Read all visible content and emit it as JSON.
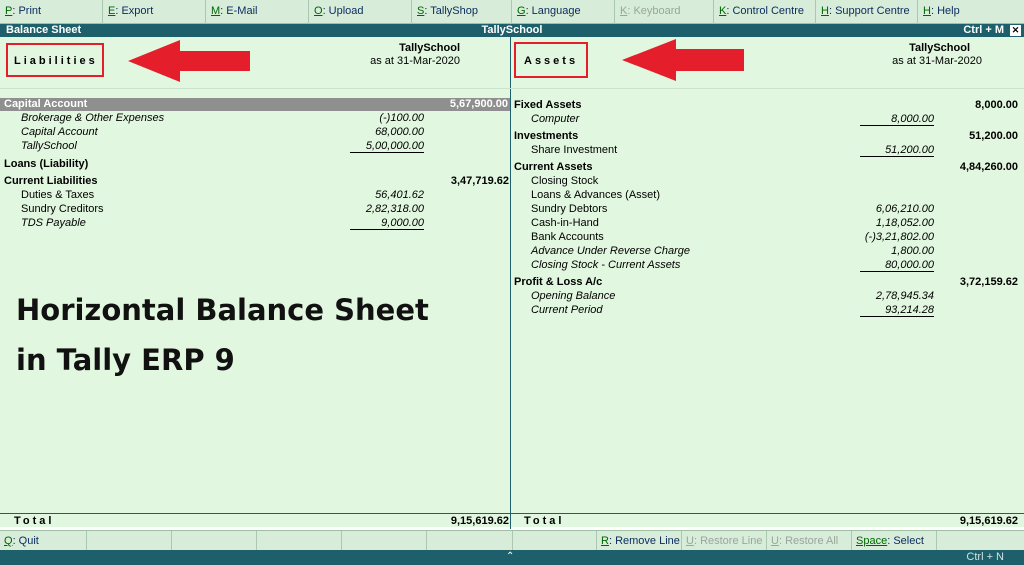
{
  "menu": [
    {
      "key": "P",
      "label": ": Print",
      "disabled": false
    },
    {
      "key": "E",
      "label": ": Export",
      "disabled": false
    },
    {
      "key": "M",
      "label": ": E-Mail",
      "disabled": false
    },
    {
      "key": "O",
      "label": ": Upload",
      "disabled": false
    },
    {
      "key": "S",
      "label": ": TallyShop",
      "disabled": false
    },
    {
      "key": "G",
      "label": ": Language",
      "disabled": false
    },
    {
      "key": "K",
      "label": ": Keyboard",
      "disabled": true
    },
    {
      "key": "K",
      "label": ": Control Centre",
      "disabled": false
    },
    {
      "key": "H",
      "label": ": Support Centre",
      "disabled": false
    },
    {
      "key": "H",
      "label": ": Help",
      "disabled": false
    }
  ],
  "titlebar": {
    "left": "Balance Sheet",
    "center": "TallySchool",
    "right": "Ctrl + M",
    "close": "✕"
  },
  "liabilities": {
    "title": "Liabilities",
    "company": "TallySchool",
    "as_at": "as at 31-Mar-2020",
    "groups": [
      {
        "name": "Capital Account",
        "total": "5,67,900.00",
        "highlighted": true,
        "items": [
          {
            "name": "Brokerage & Other Expenses",
            "amount": "(-)100.00",
            "italic": true
          },
          {
            "name": "Capital Account",
            "amount": "68,000.00",
            "italic": true
          },
          {
            "name": "TallySchool",
            "amount": "5,00,000.00",
            "italic": true
          }
        ]
      },
      {
        "name": "Loans (Liability)",
        "total": "",
        "items": []
      },
      {
        "name": "Current Liabilities",
        "total": "3,47,719.62",
        "items": [
          {
            "name": "Duties & Taxes",
            "amount": "56,401.62",
            "italic": false
          },
          {
            "name": "Sundry Creditors",
            "amount": "2,82,318.00",
            "italic": false
          },
          {
            "name": "TDS Payable",
            "amount": "9,000.00",
            "italic": true
          }
        ]
      }
    ],
    "total_label": "Total",
    "total_value": "9,15,619.62"
  },
  "assets": {
    "title": "Assets",
    "company": "TallySchool",
    "as_at": "as at 31-Mar-2020",
    "groups": [
      {
        "name": "Fixed Assets",
        "total": "8,000.00",
        "items": [
          {
            "name": "Computer",
            "amount": "8,000.00",
            "italic": true
          }
        ]
      },
      {
        "name": "Investments",
        "total": "51,200.00",
        "items": [
          {
            "name": "Share Investment",
            "amount": "51,200.00",
            "italic": false
          }
        ]
      },
      {
        "name": "Current Assets",
        "total": "4,84,260.00",
        "items": [
          {
            "name": "Closing Stock",
            "amount": "",
            "italic": false
          },
          {
            "name": "Loans & Advances (Asset)",
            "amount": "",
            "italic": false
          },
          {
            "name": "Sundry Debtors",
            "amount": "6,06,210.00",
            "italic": false
          },
          {
            "name": "Cash-in-Hand",
            "amount": "1,18,052.00",
            "italic": false
          },
          {
            "name": "Bank Accounts",
            "amount": "(-)3,21,802.00",
            "italic": false
          },
          {
            "name": "Advance Under Reverse Charge",
            "amount": "1,800.00",
            "italic": true
          },
          {
            "name": "Closing Stock - Current Assets",
            "amount": "80,000.00",
            "italic": true
          }
        ]
      },
      {
        "name": "Profit & Loss A/c",
        "total": "3,72,159.62",
        "items": [
          {
            "name": "Opening Balance",
            "amount": "2,78,945.34",
            "italic": true
          },
          {
            "name": "Current Period",
            "amount": "93,214.28",
            "italic": true
          }
        ]
      }
    ],
    "total_label": "Total",
    "total_value": "9,15,619.62"
  },
  "caption": {
    "line1": "Horizontal Balance Sheet",
    "line2": "in Tally ERP 9"
  },
  "bottom": {
    "quit": {
      "key": "Q",
      "label": ": Quit"
    },
    "remove_line": {
      "key": "R",
      "label": ": Remove Line"
    },
    "restore_line": {
      "key": "U",
      "label": ": Restore Line"
    },
    "restore_all": {
      "key": "U",
      "label": ": Restore All"
    },
    "select": {
      "key": "Space",
      "label": ": Select"
    }
  },
  "status": {
    "chevron": "⌃",
    "ctrl_n": "Ctrl + N"
  },
  "colors": {
    "accent": "#1d5f6a",
    "background": "#e2f7e0",
    "annotation": "#e41e2b"
  },
  "icons": [
    "close-icon",
    "chevron-up-icon",
    "arrow-left-icon"
  ]
}
